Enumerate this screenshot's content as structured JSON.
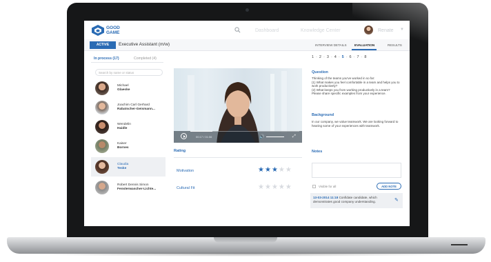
{
  "app": {
    "brand_line1": "GOOD",
    "brand_line2": "GAME",
    "nav": [
      "Dashboard",
      "Knowledge Center"
    ],
    "user_name": "Renate",
    "accent": "#2a6bb4"
  },
  "subbar": {
    "status_badge": "ACTIVE",
    "job_title": "Executive Assistant (m/w)",
    "tabs": [
      "INTERVIEW DETAILS",
      "EVALUATION",
      "RESULTS"
    ],
    "active_tab": "EVALUATION"
  },
  "candidates": {
    "filter_active": "In process (17)",
    "filter_inactive": "Completed (4)",
    "search_placeholder": "Search by name or status",
    "items": [
      {
        "first": "Michael",
        "last": "Glaeske",
        "selected": false
      },
      {
        "first": "Joachim Carl Gerhard",
        "last": "Rabatscher-Geismann...",
        "selected": false
      },
      {
        "first": "Wendelin",
        "last": "Haidle",
        "selected": false
      },
      {
        "first": "Kaiser",
        "last": "Bornes",
        "selected": false
      },
      {
        "first": "Claudia",
        "last": "Teske",
        "selected": true
      },
      {
        "first": "Robert Dennis Simon",
        "last": "Fensterwascher-Lichte...",
        "selected": false
      }
    ]
  },
  "video": {
    "time": "00:17 / 01:06",
    "progress": 0.2
  },
  "rating": {
    "title": "Rating",
    "items": [
      {
        "label": "Motivation",
        "stars": 3,
        "max": 5
      },
      {
        "label": "Cultural Fit",
        "stars": 0,
        "max": 5
      }
    ]
  },
  "steps": {
    "items": [
      "1",
      "2",
      "3",
      "4",
      "5",
      "6",
      "7",
      "8"
    ],
    "current": "5"
  },
  "question": {
    "title": "Question",
    "text": "Thinking of the teams you've worked in so far:\n(1) What makes you feel comfortable in a team and helps you to work productively?\n(2) What keeps you from working productively in a team?\nPlease share specific examples from your experience."
  },
  "background": {
    "title": "Background",
    "text": "In our company, we value teamwork. We are looking forward to hearing some of your experiences with teamwork."
  },
  "notes": {
    "title": "Notes",
    "visible_label": "Visible for all",
    "add_note_label": "ADD NOTE",
    "entry_date": "13-03-2014 11:18",
    "entry_text": "Confidate candidate, which demonstrates good company understanding."
  }
}
